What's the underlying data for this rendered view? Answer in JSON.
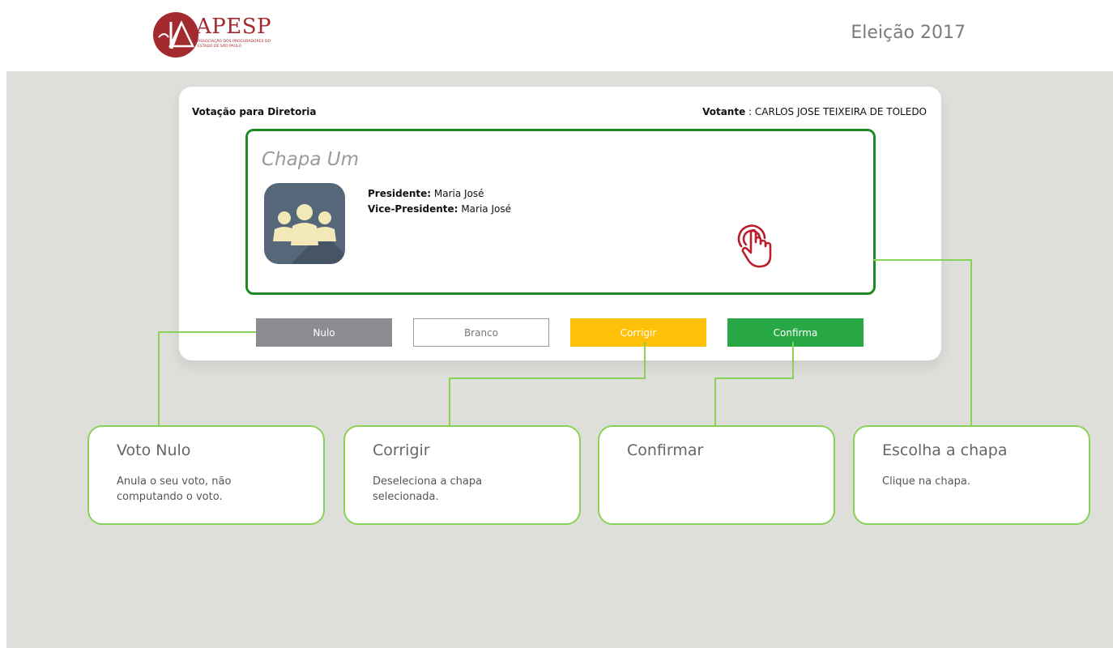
{
  "header": {
    "logo_name": "APESP",
    "logo_subtitle": "Associação dos Procuradores do Estado de São Paulo",
    "title": "Eleição 2017"
  },
  "ballot": {
    "title": "Votação para Diretoria",
    "voter_label": "Votante",
    "voter_separator": " : ",
    "voter_name": "CARLOS JOSE TEIXEIRA DE TOLEDO"
  },
  "slate": {
    "name": "Chapa Um",
    "avatar_icon": "group-icon",
    "president_label": "Presidente:",
    "president_name": "Maria José",
    "vice_label": "Vice-Presidente:",
    "vice_name": "Maria José",
    "tap_icon": "tap-hand-icon"
  },
  "buttons": {
    "nulo": "Nulo",
    "branco": "Branco",
    "corrigir": "Corrigir",
    "confirma": "Confirma"
  },
  "callouts": [
    {
      "title": "Voto Nulo",
      "text": "Anula o seu voto, não computando  o voto."
    },
    {
      "title": "Corrigir",
      "text": "Deseleciona a chapa selecionada."
    },
    {
      "title": "Confirmar",
      "text": ""
    },
    {
      "title": "Escolha a chapa",
      "text": "Clique na chapa."
    }
  ],
  "colors": {
    "brand": "#a32a2e",
    "slate_border": "#1e8a22",
    "callout_border": "#88d258",
    "nulo": "#8a8c92",
    "corrigir": "#ffc107",
    "confirma": "#28a745",
    "stage_bg": "#dedfda"
  }
}
